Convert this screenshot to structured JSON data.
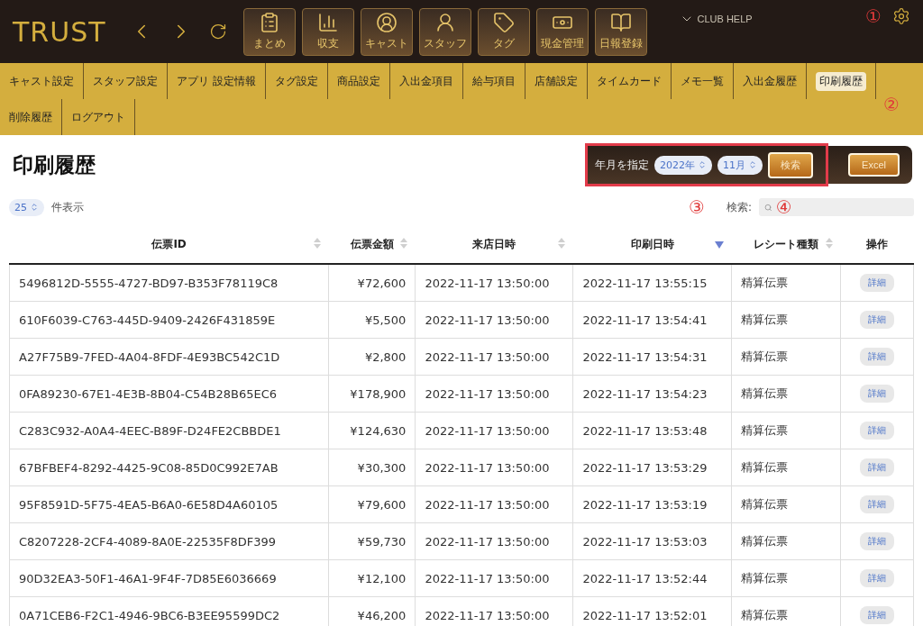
{
  "header": {
    "logo": "TRUST",
    "tools": [
      {
        "label": "まとめ"
      },
      {
        "label": "収支"
      },
      {
        "label": "キャスト"
      },
      {
        "label": "スタッフ"
      },
      {
        "label": "タグ"
      },
      {
        "label": "現金管理"
      },
      {
        "label": "日報登録"
      }
    ],
    "help": "CLUB HELP",
    "marker": "①"
  },
  "nav": {
    "items": [
      {
        "label": "キャスト設定",
        "selected": false
      },
      {
        "label": "スタッフ設定",
        "selected": false
      },
      {
        "label": "アプリ 設定情報",
        "selected": false
      },
      {
        "label": "タグ設定",
        "selected": false
      },
      {
        "label": "商品設定",
        "selected": false
      },
      {
        "label": "入出金項目",
        "selected": false
      },
      {
        "label": "給与項目",
        "selected": false
      },
      {
        "label": "店舗設定",
        "selected": false
      },
      {
        "label": "タイムカード",
        "selected": false
      },
      {
        "label": "メモ一覧",
        "selected": false
      },
      {
        "label": "入出金履歴",
        "selected": false
      },
      {
        "label": "印刷履歴",
        "selected": true
      },
      {
        "label": "削除履歴",
        "selected": false
      },
      {
        "label": "ログアウト",
        "selected": false
      }
    ],
    "marker": "②"
  },
  "page": {
    "title": "印刷履歴",
    "filter": {
      "label": "年月を指定",
      "year": "2022年",
      "month": "11月",
      "search_button": "検索",
      "marker": "③"
    },
    "excel_button": "Excel",
    "page_size": "25",
    "page_size_label": "件表示",
    "search_label": "検索:",
    "search_marker": "④"
  },
  "table": {
    "columns": [
      {
        "label": "伝票ID",
        "sortable": true,
        "sorted": false
      },
      {
        "label": "伝票金額",
        "sortable": true,
        "sorted": false
      },
      {
        "label": "来店日時",
        "sortable": true,
        "sorted": false
      },
      {
        "label": "印刷日時",
        "sortable": true,
        "sorted": true
      },
      {
        "label": "レシート種類",
        "sortable": true,
        "sorted": false
      },
      {
        "label": "操作",
        "sortable": false
      }
    ],
    "rows": [
      {
        "id": "5496812D-5555-4727-BD97-B353F78119C8",
        "amount": "¥72,600",
        "visit": "2022-11-17 13:50:00",
        "printed": "2022-11-17 13:55:15",
        "type": "精算伝票",
        "action": "詳細"
      },
      {
        "id": "610F6039-C763-445D-9409-2426F431859E",
        "amount": "¥5,500",
        "visit": "2022-11-17 13:50:00",
        "printed": "2022-11-17 13:54:41",
        "type": "精算伝票",
        "action": "詳細"
      },
      {
        "id": "A27F75B9-7FED-4A04-8FDF-4E93BC542C1D",
        "amount": "¥2,800",
        "visit": "2022-11-17 13:50:00",
        "printed": "2022-11-17 13:54:31",
        "type": "精算伝票",
        "action": "詳細"
      },
      {
        "id": "0FA89230-67E1-4E3B-8B04-C54B28B65EC6",
        "amount": "¥178,900",
        "visit": "2022-11-17 13:50:00",
        "printed": "2022-11-17 13:54:23",
        "type": "精算伝票",
        "action": "詳細"
      },
      {
        "id": "C283C932-A0A4-4EEC-B89F-D24FE2CBBDE1",
        "amount": "¥124,630",
        "visit": "2022-11-17 13:50:00",
        "printed": "2022-11-17 13:53:48",
        "type": "精算伝票",
        "action": "詳細"
      },
      {
        "id": "67BFBEF4-8292-4425-9C08-85D0C992E7AB",
        "amount": "¥30,300",
        "visit": "2022-11-17 13:50:00",
        "printed": "2022-11-17 13:53:29",
        "type": "精算伝票",
        "action": "詳細"
      },
      {
        "id": "95F8591D-5F75-4EA5-B6A0-6E58D4A60105",
        "amount": "¥79,600",
        "visit": "2022-11-17 13:50:00",
        "printed": "2022-11-17 13:53:19",
        "type": "精算伝票",
        "action": "詳細"
      },
      {
        "id": "C8207228-2CF4-4089-8A0E-22535F8DF399",
        "amount": "¥59,730",
        "visit": "2022-11-17 13:50:00",
        "printed": "2022-11-17 13:53:03",
        "type": "精算伝票",
        "action": "詳細"
      },
      {
        "id": "90D32EA3-50F1-46A1-9F4F-7D85E6036669",
        "amount": "¥12,100",
        "visit": "2022-11-17 13:50:00",
        "printed": "2022-11-17 13:52:44",
        "type": "精算伝票",
        "action": "詳細"
      },
      {
        "id": "0A71CEB6-F2C1-4946-9BC6-B3EE95599DC2",
        "amount": "¥46,200",
        "visit": "2022-11-17 13:50:00",
        "printed": "2022-11-17 13:52:01",
        "type": "精算伝票",
        "action": "詳細"
      }
    ]
  }
}
